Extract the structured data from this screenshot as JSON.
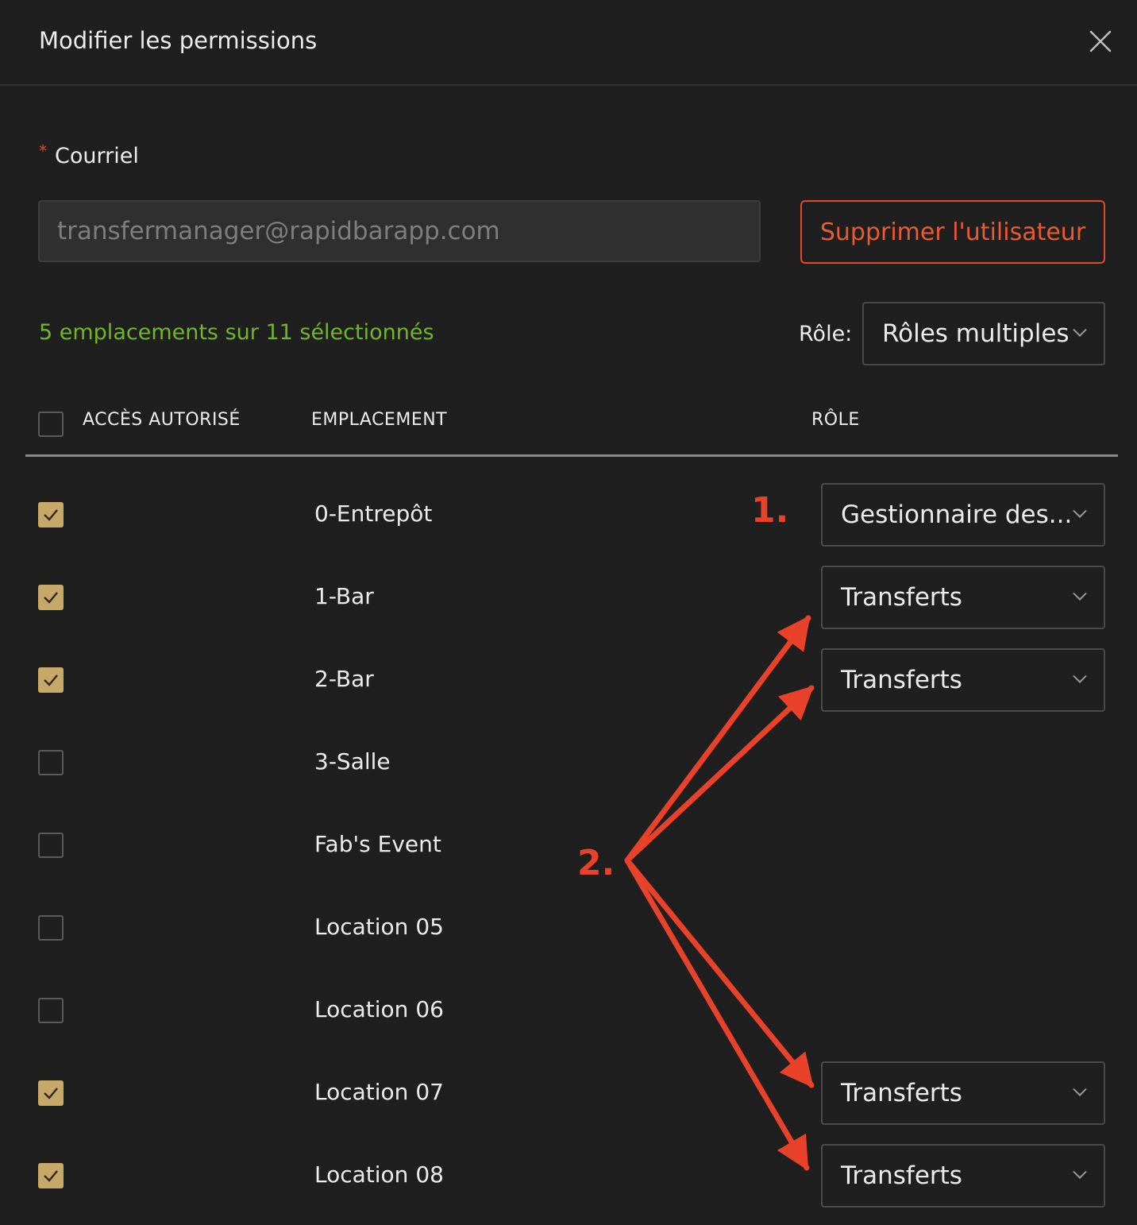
{
  "header": {
    "title": "Modifier les permissions"
  },
  "form": {
    "required_mark": "*",
    "email_label": "Courriel",
    "email_value": "transfermanager@rapidbarapp.com",
    "delete_button": "Supprimer l'utilisateur",
    "selected_count": "5 emplacements sur 11 sélectionnés",
    "role_label": "Rôle:",
    "role_select_value": "Rôles multiples"
  },
  "table": {
    "columns": {
      "access": "ACCÈS AUTORISÉ",
      "location": "EMPLACEMENT",
      "role": "RÔLE"
    },
    "rows": [
      {
        "location": "0-Entrepôt",
        "checked": true,
        "role": "Gestionnaire des..."
      },
      {
        "location": "1-Bar",
        "checked": true,
        "role": "Transferts"
      },
      {
        "location": "2-Bar",
        "checked": true,
        "role": "Transferts"
      },
      {
        "location": "3-Salle",
        "checked": false,
        "role": null
      },
      {
        "location": "Fab's Event",
        "checked": false,
        "role": null
      },
      {
        "location": "Location 05",
        "checked": false,
        "role": null
      },
      {
        "location": "Location 06",
        "checked": false,
        "role": null
      },
      {
        "location": "Location 07",
        "checked": true,
        "role": "Transferts"
      },
      {
        "location": "Location 08",
        "checked": true,
        "role": "Transferts"
      }
    ]
  },
  "annotations": {
    "one": "1.",
    "two": "2."
  },
  "colors": {
    "background": "#1f1f1f",
    "accent_gold": "#c7a869",
    "danger": "#e2492a",
    "success": "#71b52a",
    "annotation": "#e8422a"
  },
  "icons": {
    "close": "close-icon",
    "chevron": "chevron-down-icon",
    "check": "check-icon"
  }
}
